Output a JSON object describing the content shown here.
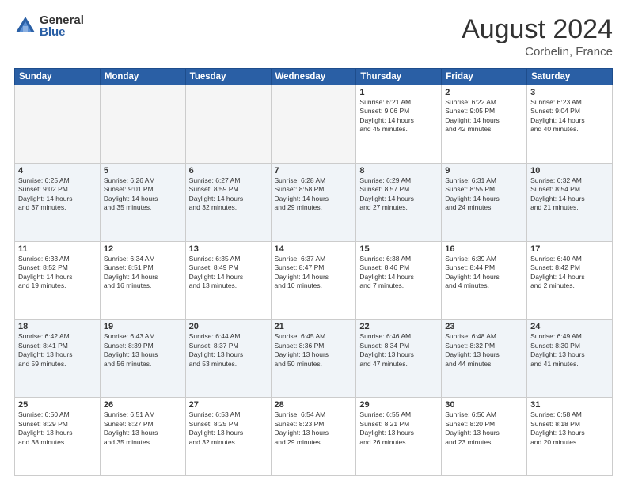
{
  "logo": {
    "general": "General",
    "blue": "Blue"
  },
  "title": {
    "month": "August 2024",
    "location": "Corbelin, France"
  },
  "days_header": [
    "Sunday",
    "Monday",
    "Tuesday",
    "Wednesday",
    "Thursday",
    "Friday",
    "Saturday"
  ],
  "weeks": [
    [
      {
        "day": "",
        "info": ""
      },
      {
        "day": "",
        "info": ""
      },
      {
        "day": "",
        "info": ""
      },
      {
        "day": "",
        "info": ""
      },
      {
        "day": "1",
        "info": "Sunrise: 6:21 AM\nSunset: 9:06 PM\nDaylight: 14 hours\nand 45 minutes."
      },
      {
        "day": "2",
        "info": "Sunrise: 6:22 AM\nSunset: 9:05 PM\nDaylight: 14 hours\nand 42 minutes."
      },
      {
        "day": "3",
        "info": "Sunrise: 6:23 AM\nSunset: 9:04 PM\nDaylight: 14 hours\nand 40 minutes."
      }
    ],
    [
      {
        "day": "4",
        "info": "Sunrise: 6:25 AM\nSunset: 9:02 PM\nDaylight: 14 hours\nand 37 minutes."
      },
      {
        "day": "5",
        "info": "Sunrise: 6:26 AM\nSunset: 9:01 PM\nDaylight: 14 hours\nand 35 minutes."
      },
      {
        "day": "6",
        "info": "Sunrise: 6:27 AM\nSunset: 8:59 PM\nDaylight: 14 hours\nand 32 minutes."
      },
      {
        "day": "7",
        "info": "Sunrise: 6:28 AM\nSunset: 8:58 PM\nDaylight: 14 hours\nand 29 minutes."
      },
      {
        "day": "8",
        "info": "Sunrise: 6:29 AM\nSunset: 8:57 PM\nDaylight: 14 hours\nand 27 minutes."
      },
      {
        "day": "9",
        "info": "Sunrise: 6:31 AM\nSunset: 8:55 PM\nDaylight: 14 hours\nand 24 minutes."
      },
      {
        "day": "10",
        "info": "Sunrise: 6:32 AM\nSunset: 8:54 PM\nDaylight: 14 hours\nand 21 minutes."
      }
    ],
    [
      {
        "day": "11",
        "info": "Sunrise: 6:33 AM\nSunset: 8:52 PM\nDaylight: 14 hours\nand 19 minutes."
      },
      {
        "day": "12",
        "info": "Sunrise: 6:34 AM\nSunset: 8:51 PM\nDaylight: 14 hours\nand 16 minutes."
      },
      {
        "day": "13",
        "info": "Sunrise: 6:35 AM\nSunset: 8:49 PM\nDaylight: 14 hours\nand 13 minutes."
      },
      {
        "day": "14",
        "info": "Sunrise: 6:37 AM\nSunset: 8:47 PM\nDaylight: 14 hours\nand 10 minutes."
      },
      {
        "day": "15",
        "info": "Sunrise: 6:38 AM\nSunset: 8:46 PM\nDaylight: 14 hours\nand 7 minutes."
      },
      {
        "day": "16",
        "info": "Sunrise: 6:39 AM\nSunset: 8:44 PM\nDaylight: 14 hours\nand 4 minutes."
      },
      {
        "day": "17",
        "info": "Sunrise: 6:40 AM\nSunset: 8:42 PM\nDaylight: 14 hours\nand 2 minutes."
      }
    ],
    [
      {
        "day": "18",
        "info": "Sunrise: 6:42 AM\nSunset: 8:41 PM\nDaylight: 13 hours\nand 59 minutes."
      },
      {
        "day": "19",
        "info": "Sunrise: 6:43 AM\nSunset: 8:39 PM\nDaylight: 13 hours\nand 56 minutes."
      },
      {
        "day": "20",
        "info": "Sunrise: 6:44 AM\nSunset: 8:37 PM\nDaylight: 13 hours\nand 53 minutes."
      },
      {
        "day": "21",
        "info": "Sunrise: 6:45 AM\nSunset: 8:36 PM\nDaylight: 13 hours\nand 50 minutes."
      },
      {
        "day": "22",
        "info": "Sunrise: 6:46 AM\nSunset: 8:34 PM\nDaylight: 13 hours\nand 47 minutes."
      },
      {
        "day": "23",
        "info": "Sunrise: 6:48 AM\nSunset: 8:32 PM\nDaylight: 13 hours\nand 44 minutes."
      },
      {
        "day": "24",
        "info": "Sunrise: 6:49 AM\nSunset: 8:30 PM\nDaylight: 13 hours\nand 41 minutes."
      }
    ],
    [
      {
        "day": "25",
        "info": "Sunrise: 6:50 AM\nSunset: 8:29 PM\nDaylight: 13 hours\nand 38 minutes."
      },
      {
        "day": "26",
        "info": "Sunrise: 6:51 AM\nSunset: 8:27 PM\nDaylight: 13 hours\nand 35 minutes."
      },
      {
        "day": "27",
        "info": "Sunrise: 6:53 AM\nSunset: 8:25 PM\nDaylight: 13 hours\nand 32 minutes."
      },
      {
        "day": "28",
        "info": "Sunrise: 6:54 AM\nSunset: 8:23 PM\nDaylight: 13 hours\nand 29 minutes."
      },
      {
        "day": "29",
        "info": "Sunrise: 6:55 AM\nSunset: 8:21 PM\nDaylight: 13 hours\nand 26 minutes."
      },
      {
        "day": "30",
        "info": "Sunrise: 6:56 AM\nSunset: 8:20 PM\nDaylight: 13 hours\nand 23 minutes."
      },
      {
        "day": "31",
        "info": "Sunrise: 6:58 AM\nSunset: 8:18 PM\nDaylight: 13 hours\nand 20 minutes."
      }
    ]
  ]
}
